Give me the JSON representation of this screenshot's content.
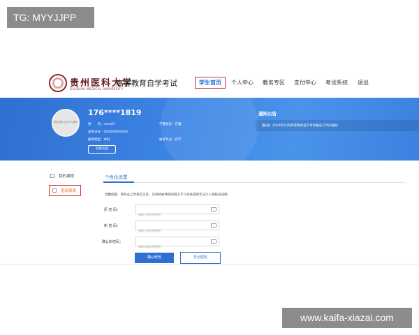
{
  "watermarks": {
    "top_left": "TG: MYYJJPP",
    "bottom_right": "www.kaifa-xiazai.com"
  },
  "header": {
    "logo_name": "贵州医科大学",
    "logo_en": "GUIZHOU MEDICAL UNIVERSITY",
    "site_title": "高等教育自学考试",
    "nav": [
      {
        "label": "学生首页"
      },
      {
        "label": "个人中心"
      },
      {
        "label": "教务专区"
      },
      {
        "label": "支付中心"
      },
      {
        "label": "考试系统"
      },
      {
        "label": "退出"
      }
    ]
  },
  "profile": {
    "avatar_text": "您还没有上传个人照片",
    "name": "176****1819",
    "name_label": "姓　　名：",
    "name_value": "cehs01",
    "study_status": "学籍状态：在籍",
    "exam_no_label": "准考证号：",
    "exam_no_value": "000000000000",
    "category_label": "报考类型：",
    "category_value": "本科",
    "major_label": "报考专业：",
    "major_value": "药学",
    "complete_button": "完善信息"
  },
  "notice": {
    "title": "通知公告",
    "item": "【报名】2019年10月高等教育自学考试报名工作的通知"
  },
  "sidebar": {
    "items": [
      {
        "label": "我的课程"
      },
      {
        "label": "密码修改"
      }
    ]
  },
  "form": {
    "tab": "个性化设置",
    "tip": "温馨提醒：请务必上传真实信息，否则将被课程的网上学习考核成绩无法计入课程总成绩。",
    "fields": [
      {
        "label": "原 密 码：",
        "placeholder": "请输入您的原密码"
      },
      {
        "label": "新 密 码：",
        "placeholder": "请输入您的新密码"
      },
      {
        "label": "确认新密码：",
        "placeholder": "请再次确认新密码"
      }
    ],
    "confirm_button": "确认修改",
    "forgot_button": "忘记密码"
  },
  "colors": {
    "primary": "#2f6fcf",
    "highlight_border": "#d9312b",
    "active_sidebar": "#e0701a"
  }
}
